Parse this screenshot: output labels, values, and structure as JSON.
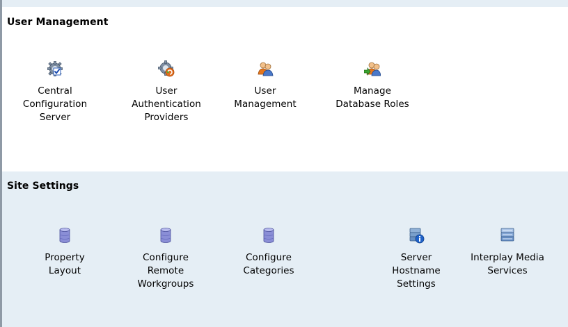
{
  "colors": {
    "section_alt_bg": "#e5eef5",
    "left_border": "#8f9aa6"
  },
  "user_management": {
    "title": "User Management",
    "items": [
      {
        "label": "Central\nConfiguration\nServer",
        "icon": "gear-checkmark-icon"
      },
      {
        "label": "User\nAuthentication\nProviders",
        "icon": "gear-refresh-icon"
      },
      {
        "label": "User\nManagement",
        "icon": "users-icon"
      },
      {
        "label": "Manage\nDatabase Roles",
        "icon": "users-arrow-icon"
      }
    ]
  },
  "site_settings": {
    "title": "Site Settings",
    "items": [
      {
        "label": "Property\nLayout",
        "icon": "database-icon"
      },
      {
        "label": "Configure\nRemote\nWorkgroups",
        "icon": "database-icon"
      },
      {
        "label": "Configure\nCategories",
        "icon": "database-icon"
      },
      {
        "label": "Server\nHostname\nSettings",
        "icon": "server-info-icon"
      },
      {
        "label": "Interplay Media\nServices",
        "icon": "server-stack-icon"
      }
    ]
  }
}
